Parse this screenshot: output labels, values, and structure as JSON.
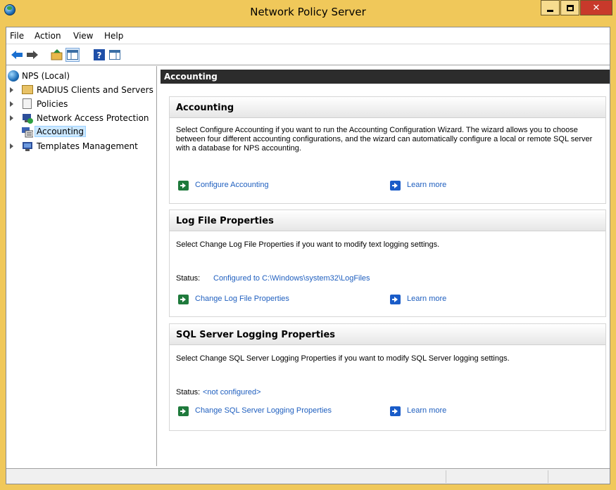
{
  "window": {
    "title": "Network Policy Server"
  },
  "menu": [
    "File",
    "Action",
    "View",
    "Help"
  ],
  "toolbar": [
    "back-icon",
    "forward-icon",
    "up-folder-icon",
    "show-hide-tree-icon",
    "help-icon",
    "action-pane-icon"
  ],
  "tree": {
    "root": "NPS (Local)",
    "items": [
      {
        "label": "RADIUS Clients and Servers",
        "icon": "folder-icon",
        "expandable": true
      },
      {
        "label": "Policies",
        "icon": "policies-icon",
        "expandable": true
      },
      {
        "label": "Network Access Protection",
        "icon": "nap-icon",
        "expandable": true
      },
      {
        "label": "Accounting",
        "icon": "accounting-icon",
        "expandable": false,
        "selected": true
      },
      {
        "label": "Templates Management",
        "icon": "templates-icon",
        "expandable": true
      }
    ]
  },
  "content": {
    "header": "Accounting",
    "accounting": {
      "title": "Accounting",
      "description": "Select Configure Accounting if you want to run the Accounting Configuration Wizard. The wizard allows you to choose between four different accounting configurations, and the wizard can automatically configure a local or remote SQL server with a database for NPS accounting.",
      "action": "Configure Accounting",
      "learn_more": "Learn more"
    },
    "log_file": {
      "title": "Log File Properties",
      "description": "Select Change Log File Properties if you want to modify text logging settings.",
      "status_label": "Status:",
      "status_value": "Configured to C:\\Windows\\system32\\LogFiles",
      "action": "Change Log File Properties",
      "learn_more": "Learn more"
    },
    "sql": {
      "title": "SQL Server Logging Properties",
      "description": "Select Change SQL Server Logging Properties if you want to modify SQL Server logging settings.",
      "status_label": "Status:",
      "status_value": "<not configured>",
      "action": "Change SQL Server Logging Properties",
      "learn_more": "Learn more"
    }
  },
  "colors": {
    "frame": "#f0c85a",
    "header_bar": "#2c2c2c",
    "link": "#1f5fbf",
    "action_icon": "#1f7a3c",
    "learn_icon": "#1a5cc8",
    "close_button": "#c8392b"
  }
}
